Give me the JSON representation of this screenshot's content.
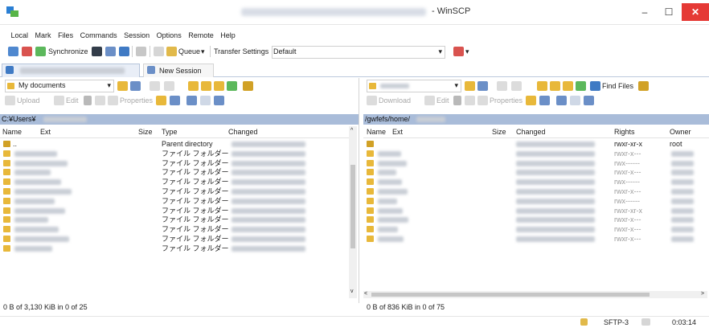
{
  "window": {
    "title": "- WinSCP",
    "controls": {
      "minimize": "–",
      "maximize": "☐",
      "close": "✕"
    }
  },
  "menu": [
    "Local",
    "Mark",
    "Files",
    "Commands",
    "Session",
    "Options",
    "Remote",
    "Help"
  ],
  "toolbar": {
    "synchronize": "Synchronize",
    "queue": "Queue",
    "queue_arrow": "▾",
    "transfer_settings": "Transfer Settings",
    "transfer_profile": "Default",
    "combo_arrow": "▾"
  },
  "tabs": {
    "new_session": "New Session"
  },
  "left": {
    "location": "My documents",
    "actions": {
      "upload": "Upload",
      "edit": "Edit",
      "properties": "Properties"
    },
    "path": "C:¥Users¥",
    "columns": {
      "name": "Name",
      "ext": "Ext",
      "size": "Size",
      "type": "Type",
      "changed": "Changed"
    },
    "rows": [
      {
        "name": "..",
        "type": "Parent directory"
      },
      {
        "name": "",
        "type": "ファイル フォルダー"
      },
      {
        "name": "",
        "type": "ファイル フォルダー"
      },
      {
        "name": "",
        "type": "ファイル フォルダー"
      },
      {
        "name": "",
        "type": "ファイル フォルダー"
      },
      {
        "name": "",
        "type": "ファイル フォルダー"
      },
      {
        "name": "",
        "type": "ファイル フォルダー"
      },
      {
        "name": "",
        "type": "ファイル フォルダー"
      },
      {
        "name": "",
        "type": "ファイル フォルダー"
      },
      {
        "name": "",
        "type": "ファイル フォルダー"
      },
      {
        "name": "",
        "type": "ファイル フォルダー"
      },
      {
        "name": "",
        "type": "ファイル フォルダー"
      }
    ],
    "status": "0 B of 3,130 KiB in 0 of 25"
  },
  "right": {
    "actions": {
      "download": "Download",
      "edit": "Edit",
      "properties": "Properties",
      "find_files": "Find Files"
    },
    "path": "/gwfefs/home/",
    "columns": {
      "name": "Name",
      "ext": "Ext",
      "size": "Size",
      "changed": "Changed",
      "rights": "Rights",
      "owner": "Owner"
    },
    "rows": [
      {
        "rights": "rwxr-xr-x",
        "owner": "root"
      },
      {
        "rights": "rwxr-x---",
        "owner": ""
      },
      {
        "rights": "rwx------",
        "owner": ""
      },
      {
        "rights": "rwxr-x---",
        "owner": ""
      },
      {
        "rights": "rwx------",
        "owner": ""
      },
      {
        "rights": "rwxr-x---",
        "owner": ""
      },
      {
        "rights": "rwx------",
        "owner": ""
      },
      {
        "rights": "rwxr-xr-x",
        "owner": ""
      },
      {
        "rights": "rwxr-x---",
        "owner": ""
      },
      {
        "rights": "rwxr-x---",
        "owner": ""
      },
      {
        "rights": "rwxr-x---",
        "owner": ""
      }
    ],
    "status": "0 B of 836 KiB in 0 of 75"
  },
  "statusbar": {
    "protocol": "SFTP-3",
    "elapsed": "0:03:14"
  },
  "colors": {
    "path_bar": "#a9bcd9",
    "folder": "#e8b83a",
    "close": "#e53935"
  }
}
